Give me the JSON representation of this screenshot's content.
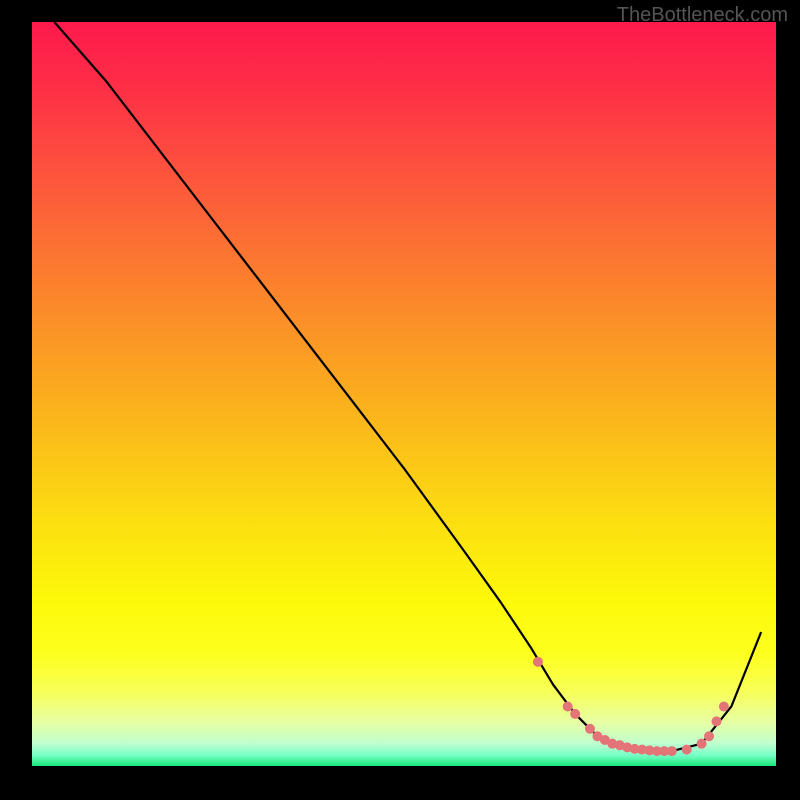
{
  "watermark": "TheBottleneck.com",
  "chart_data": {
    "type": "line",
    "title": "",
    "xlabel": "",
    "ylabel": "",
    "xlim": [
      0,
      100
    ],
    "ylim": [
      0,
      100
    ],
    "curve": {
      "x": [
        3,
        10,
        20,
        30,
        40,
        50,
        58,
        63,
        67,
        70,
        73,
        76,
        79,
        82,
        86,
        90,
        94,
        98
      ],
      "y": [
        100,
        92,
        79,
        66,
        53,
        40,
        29,
        22,
        16,
        11,
        7,
        4,
        2.5,
        2,
        2,
        3,
        8,
        18
      ]
    },
    "markers": {
      "x": [
        68,
        72,
        73,
        75,
        76,
        77,
        78,
        79,
        80,
        81,
        82,
        83,
        84,
        85,
        86,
        88,
        90,
        91,
        92,
        93
      ],
      "y": [
        14,
        8,
        7,
        5,
        4,
        3.5,
        3,
        2.8,
        2.5,
        2.3,
        2.2,
        2.1,
        2,
        2,
        2,
        2.2,
        3,
        4,
        6,
        8
      ],
      "color": "#e37478",
      "size": 5
    },
    "gradient_stops": [
      {
        "offset": 0.0,
        "color": "#fe1a4c"
      },
      {
        "offset": 0.08,
        "color": "#fe2c47"
      },
      {
        "offset": 0.18,
        "color": "#fd4c3f"
      },
      {
        "offset": 0.3,
        "color": "#fc7133"
      },
      {
        "offset": 0.42,
        "color": "#fb9526"
      },
      {
        "offset": 0.55,
        "color": "#fbbb1a"
      },
      {
        "offset": 0.68,
        "color": "#fce110"
      },
      {
        "offset": 0.78,
        "color": "#fdf90a"
      },
      {
        "offset": 0.85,
        "color": "#fdff1e"
      },
      {
        "offset": 0.9,
        "color": "#f7ff58"
      },
      {
        "offset": 0.94,
        "color": "#e8ffa2"
      },
      {
        "offset": 0.97,
        "color": "#bfffcf"
      },
      {
        "offset": 0.985,
        "color": "#7affc8"
      },
      {
        "offset": 1.0,
        "color": "#17e87a"
      }
    ]
  }
}
